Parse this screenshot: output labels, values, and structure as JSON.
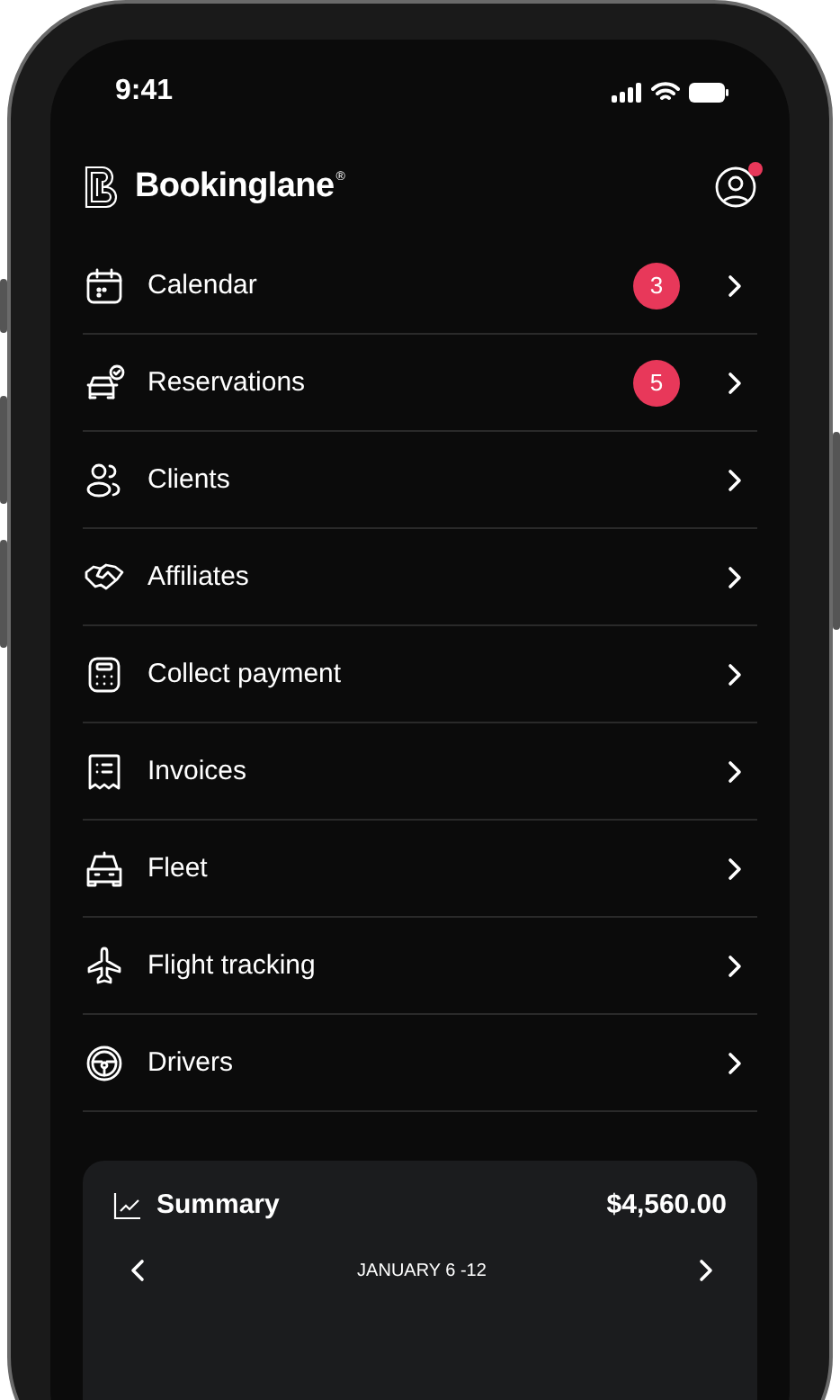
{
  "status_bar": {
    "time": "9:41"
  },
  "header": {
    "brand": "Bookinglane",
    "brand_mark": "®",
    "profile": {
      "notification": true
    }
  },
  "menu": [
    {
      "label": "Calendar",
      "badge": "3"
    },
    {
      "label": "Reservations",
      "badge": "5"
    },
    {
      "label": "Clients"
    },
    {
      "label": "Affiliates"
    },
    {
      "label": "Collect payment"
    },
    {
      "label": "Invoices"
    },
    {
      "label": "Fleet"
    },
    {
      "label": "Flight tracking"
    },
    {
      "label": "Drivers"
    }
  ],
  "summary": {
    "title": "Summary",
    "total": "$4,560.00",
    "period": "JANUARY 6 -12"
  }
}
